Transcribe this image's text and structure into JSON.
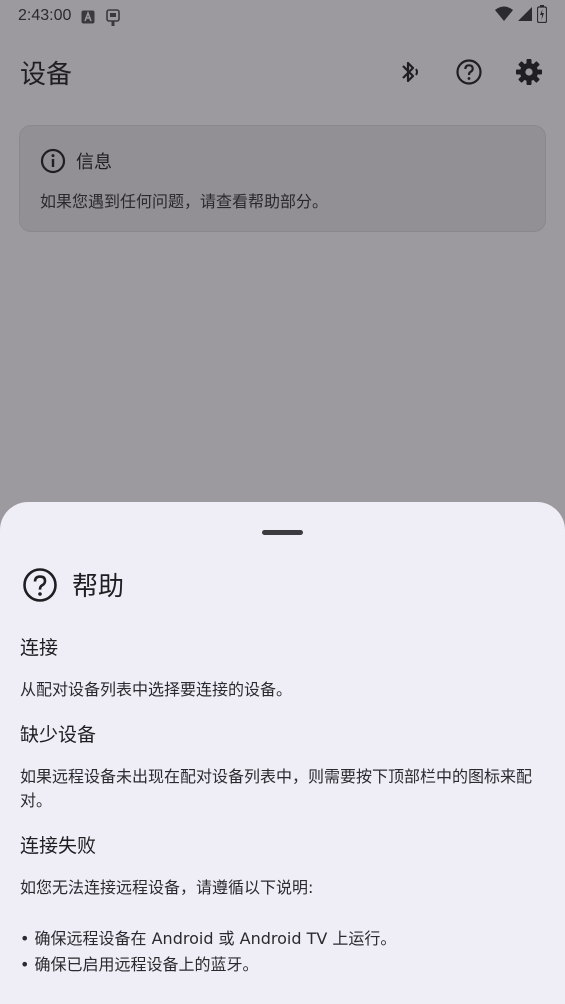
{
  "status_bar": {
    "time": "2:43:00",
    "left_icons": [
      "font-a-icon",
      "notification-usb-icon"
    ],
    "right_icons": [
      "wifi-icon",
      "signal-icon",
      "battery-icon"
    ]
  },
  "app_bar": {
    "title": "设备",
    "actions": [
      "bluetooth-pair-icon",
      "help-icon",
      "settings-icon"
    ]
  },
  "info_card": {
    "title": "信息",
    "text": "如果您遇到任何问题，请查看帮助部分。"
  },
  "help_sheet": {
    "title": "帮助",
    "sections": [
      {
        "heading": "连接",
        "text": "从配对设备列表中选择要连接的设备。"
      },
      {
        "heading": "缺少设备",
        "text": "如果远程设备未出现在配对设备列表中，则需要按下顶部栏中的图标来配对。"
      },
      {
        "heading": "连接失败",
        "text": "如您无法连接远程设备，请遵循以下说明:"
      }
    ],
    "bullets": [
      "• 确保远程设备在 Android 或 Android TV 上运行。",
      "• 确保已启用远程设备上的蓝牙。"
    ]
  },
  "colors": {
    "scrim_background": "#9c9a9f",
    "sheet_background": "#efedf6",
    "card_background": "#929095"
  }
}
